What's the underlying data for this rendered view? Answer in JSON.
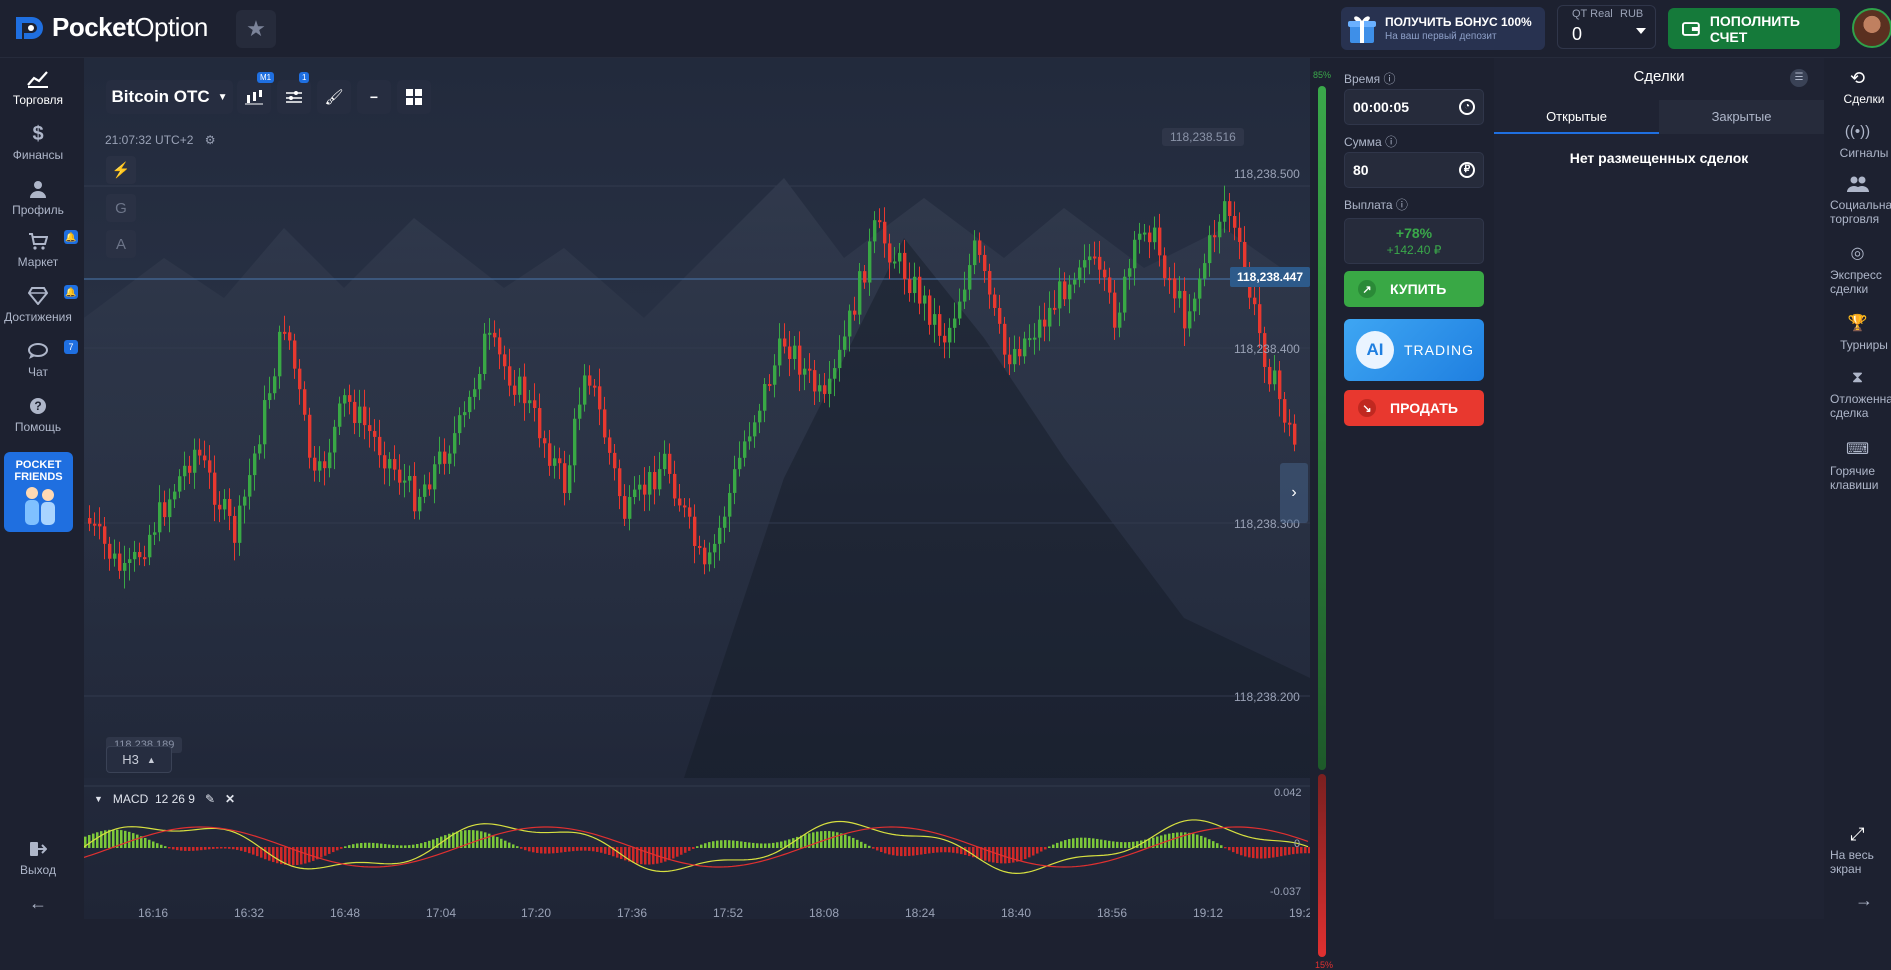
{
  "brand": {
    "name_bold": "Pocket",
    "name_regular": "Option"
  },
  "bonus": {
    "title": "ПОЛУЧИТЬ БОНУС 100%",
    "subtitle": "На ваш первый депозит"
  },
  "account": {
    "type": "QT Real",
    "currency": "RUB",
    "balance": "0"
  },
  "deposit_label": "ПОПОЛНИТЬ СЧЕТ",
  "left_nav": [
    {
      "label": "Торговля",
      "icon": "chart-line-icon",
      "active": true
    },
    {
      "label": "Финансы",
      "icon": "dollar-icon"
    },
    {
      "label": "Профиль",
      "icon": "user-icon"
    },
    {
      "label": "Маркет",
      "icon": "cart-icon",
      "badge": "🔔"
    },
    {
      "label": "Достижения",
      "icon": "diamond-icon",
      "badge": "🔔"
    },
    {
      "label": "Чат",
      "icon": "chat-icon",
      "badge": "7"
    },
    {
      "label": "Помощь",
      "icon": "help-icon"
    }
  ],
  "friends": {
    "line1": "POCKET",
    "line2": "FRIENDS"
  },
  "logout_label": "Выход",
  "chart_toolbar": {
    "asset": "Bitcoin OTC",
    "timeframe_badge": "M1",
    "indicators_badge": "1"
  },
  "clock": "21:07:32 UTC+2",
  "side_tools": [
    "G",
    "A"
  ],
  "price_axis": [
    "118,238.500",
    "118,238.400",
    "118,238.300",
    "118,238.200"
  ],
  "current_price": "118,238.447",
  "high_price": "118,238.516",
  "low_price": "118,238.189",
  "zoom_label": "H3",
  "macd": {
    "label": "MACD",
    "params": "12 26 9",
    "top": "0.042",
    "zero": "0",
    "bottom": "-0.037"
  },
  "time_axis": [
    "16:16",
    "16:32",
    "16:48",
    "17:04",
    "17:20",
    "17:36",
    "17:52",
    "18:08",
    "18:24",
    "18:40",
    "18:56",
    "19:12",
    "19:2"
  ],
  "sentiment": {
    "up": "85%",
    "down": "15%",
    "up_fraction": 0.85
  },
  "trade": {
    "time_label": "Время",
    "time_value": "00:00:05",
    "amount_label": "Сумма",
    "amount_value": "80",
    "payout_label": "Выплата",
    "payout_pct": "+78%",
    "payout_amount": "+142.40 ₽",
    "buy_label": "КУПИТЬ",
    "ai_label": "AI",
    "ai_text": "TRADING",
    "sell_label": "ПРОДАТЬ"
  },
  "deals": {
    "title": "Сделки",
    "tab_open": "Открытые",
    "tab_closed": "Закрытые",
    "empty": "Нет размещенных сделок"
  },
  "right_nav": [
    {
      "label": "Сделки",
      "icon": "history-icon",
      "active": true
    },
    {
      "label": "Сигналы",
      "icon": "signal-icon"
    },
    {
      "label": "Социальная торговля",
      "icon": "users-icon"
    },
    {
      "label": "Экспресс сделки",
      "icon": "express-icon"
    },
    {
      "label": "Турниры",
      "icon": "trophy-icon"
    },
    {
      "label": "Отложенная сделка",
      "icon": "hourglass-icon"
    },
    {
      "label": "Горячие клавиши",
      "icon": "keyboard-icon"
    }
  ],
  "fullscreen_label": "На весь экран",
  "colors": {
    "up": "#39a845",
    "down": "#e8382f",
    "accent": "#1f6fe0"
  }
}
